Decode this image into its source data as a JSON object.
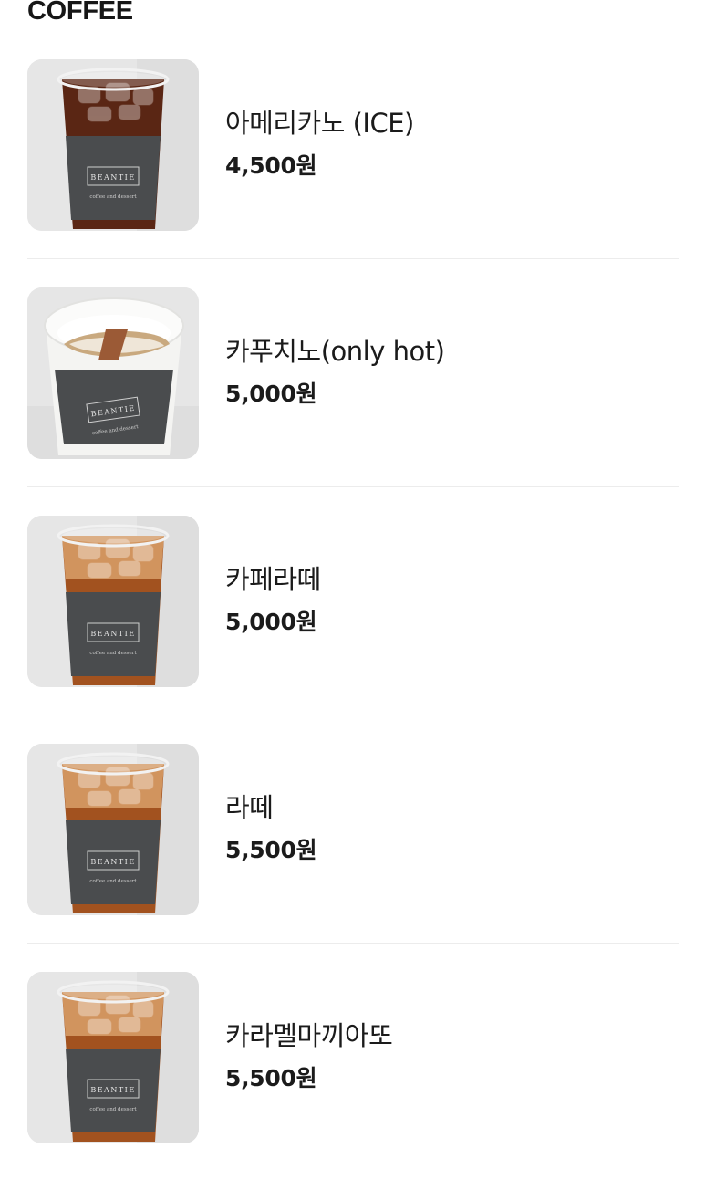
{
  "section": {
    "title": "COFFEE"
  },
  "items": [
    {
      "name": "아메리카노 (ICE)",
      "price": "4,500원",
      "drink": "iced-americano",
      "sleeve_text": "BEANTIE",
      "sleeve_sub": "coffee and dessert"
    },
    {
      "name": "카푸치노(only hot)",
      "price": "5,000원",
      "drink": "hot-cappuccino",
      "sleeve_text": "BEANTIE",
      "sleeve_sub": "coffee and dessert"
    },
    {
      "name": "카페라떼",
      "price": "5,000원",
      "drink": "iced-latte",
      "sleeve_text": "BEANTIE",
      "sleeve_sub": "coffee and dessert"
    },
    {
      "name": "라떼",
      "price": "5,500원",
      "drink": "iced-latte",
      "sleeve_text": "BEANTIE",
      "sleeve_sub": "coffee and dessert"
    },
    {
      "name": "카라멜마끼아또",
      "price": "5,500원",
      "drink": "iced-caramel-macchiato",
      "sleeve_text": "BEANTIE",
      "sleeve_sub": "coffee and dessert"
    }
  ],
  "colors": {
    "text": "#1b1b1b",
    "divider": "#ececec",
    "sleeve": "#4a4c4e",
    "americano": "#5a2614",
    "latte": "#a2521f",
    "photo_bg": "#e6e6e6"
  }
}
